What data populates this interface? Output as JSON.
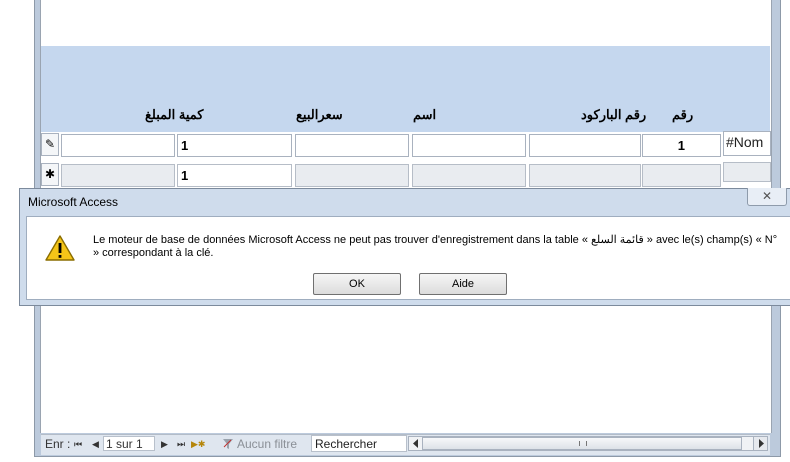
{
  "form": {
    "labels": {
      "number": "رقم",
      "barcode": "رقم الباركود",
      "name": "اسم",
      "sale_price": "سعرالبيع",
      "amount_qty": "كمية المبلغ"
    },
    "current_row": {
      "selector_glyph": "✎",
      "number": "1",
      "qty": "1",
      "error_value": "#Nom"
    },
    "new_row": {
      "selector_glyph": "✱",
      "qty": "1"
    }
  },
  "navbar": {
    "record_label": "Enr :",
    "first_icon": "⏮",
    "prev_icon": "◀",
    "current": "1 sur 1",
    "next_icon": "▶",
    "last_icon": "⏭",
    "new_icon": "▶✱",
    "filter_label": "Aucun filtre",
    "search_label": "Rechercher"
  },
  "dialog": {
    "title": "Microsoft Access",
    "close_glyph": "✕",
    "message": "Le moteur de base de données Microsoft Access ne peut pas trouver d'enregistrement dans la table « قائمة السلع » avec le(s) champ(s) « N° » correspondant à la clé.",
    "ok_label": "OK",
    "help_label": "Aide"
  },
  "colors": {
    "header_band": "#c5d7ee",
    "dialog_bg": "#cfdcec",
    "warning": "#f2c200"
  }
}
